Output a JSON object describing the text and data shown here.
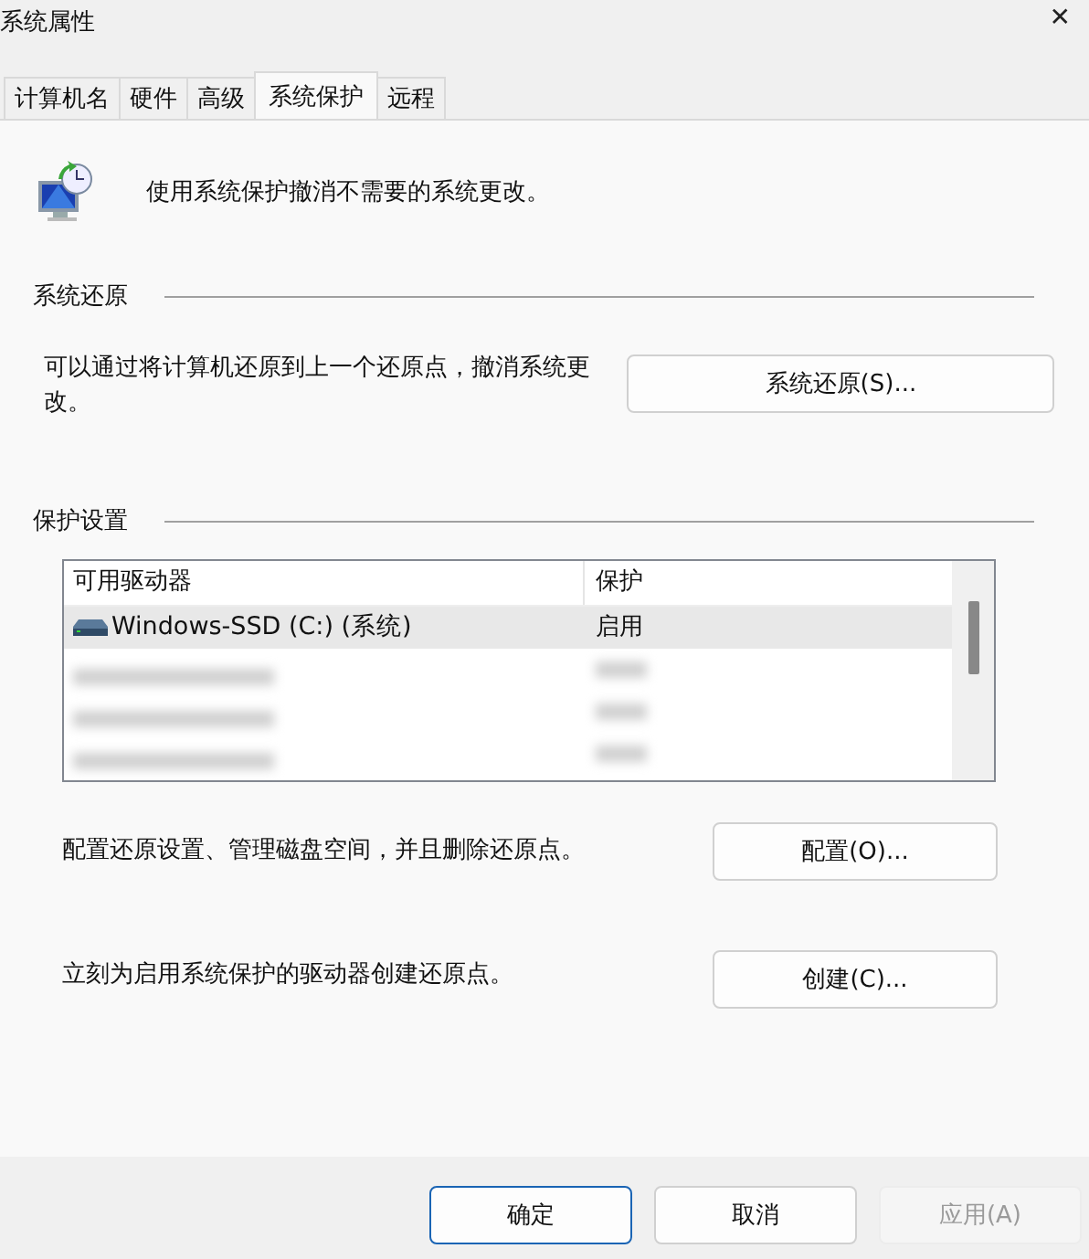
{
  "window": {
    "title": "系统属性",
    "close": "✕"
  },
  "tabs": [
    {
      "label": "计算机名",
      "selected": false
    },
    {
      "label": "硬件",
      "selected": false
    },
    {
      "label": "高级",
      "selected": false
    },
    {
      "label": "系统保护",
      "selected": true
    },
    {
      "label": "远程",
      "selected": false
    }
  ],
  "intro": "使用系统保护撤消不需要的系统更改。",
  "restore": {
    "heading": "系统还原",
    "text": "可以通过将计算机还原到上一个还原点，撤消系统更改。",
    "button": "系统还原(S)..."
  },
  "protection": {
    "heading": "保护设置",
    "columns": [
      "可用驱动器",
      "保护"
    ],
    "rows": [
      {
        "kind": "drive",
        "name": "Windows-SSD (C:) (系统)",
        "status": "启用",
        "selected": true
      },
      {
        "kind": "redacted"
      },
      {
        "kind": "redacted"
      },
      {
        "kind": "redacted"
      }
    ],
    "actions": [
      {
        "text": "配置还原设置、管理磁盘空间，并且删除还原点。",
        "button": "配置(O)..."
      },
      {
        "text": "立刻为启用系统保护的驱动器创建还原点。",
        "button": "创建(C)..."
      }
    ]
  },
  "buttons": [
    {
      "label": "确定",
      "kind": "default",
      "disabled": false
    },
    {
      "label": "取消",
      "kind": "normal",
      "disabled": false
    },
    {
      "label": "应用(A)",
      "kind": "normal",
      "disabled": true
    }
  ]
}
